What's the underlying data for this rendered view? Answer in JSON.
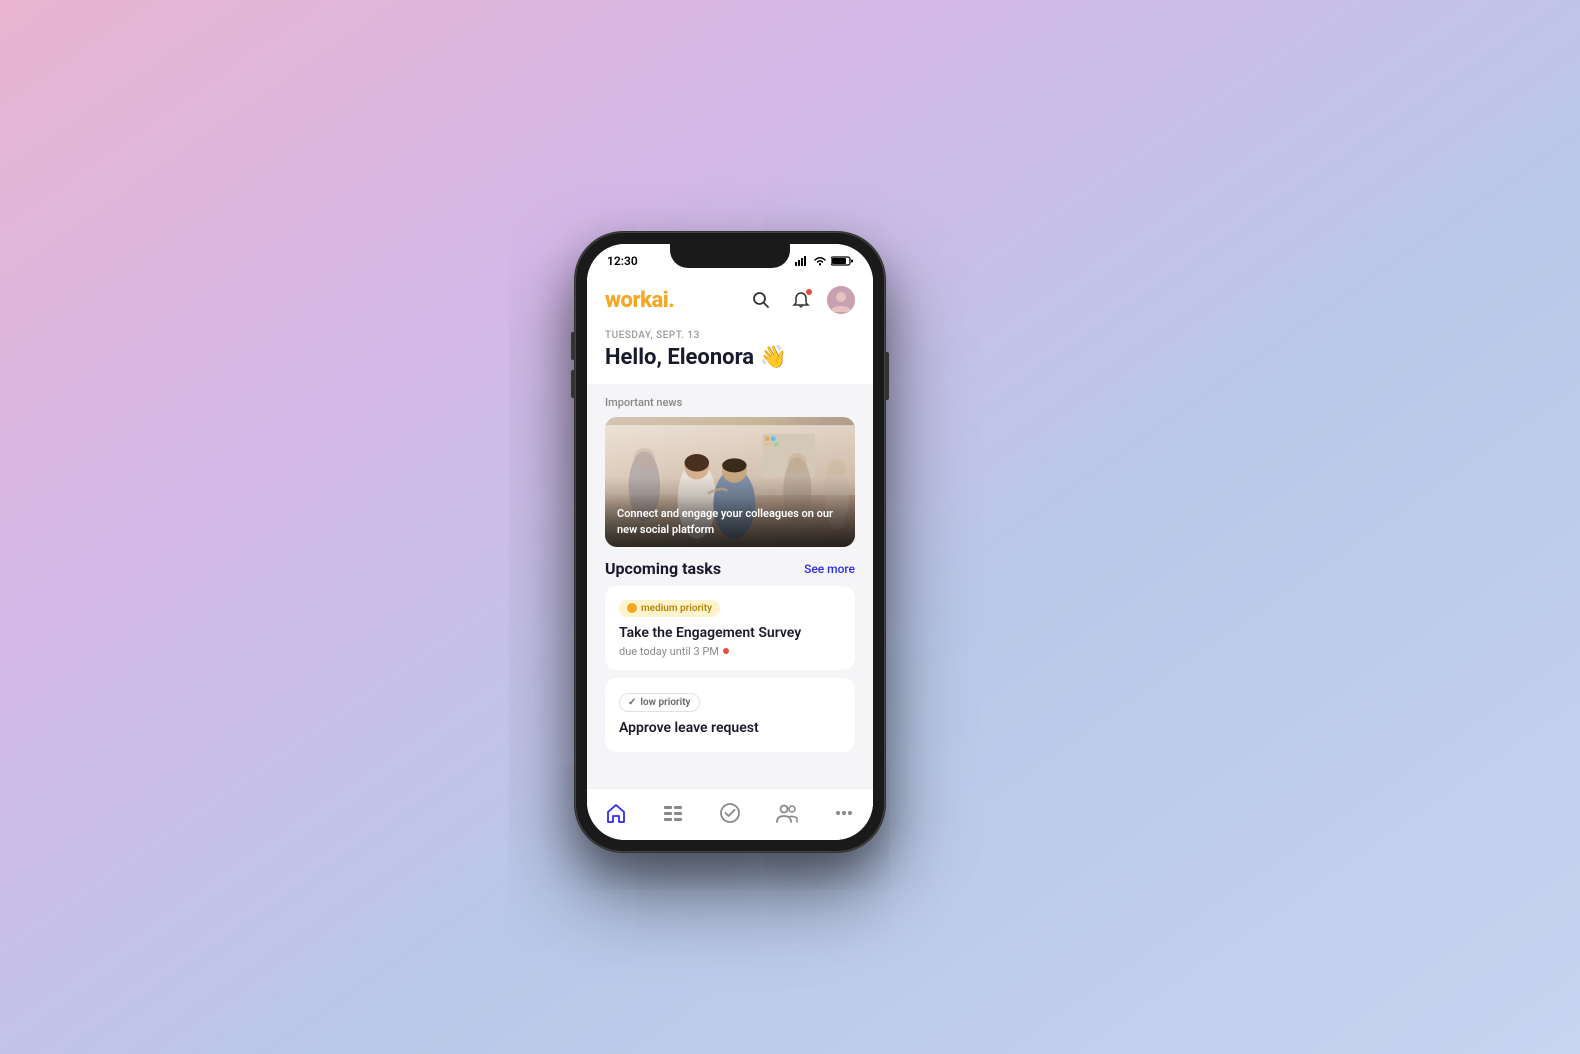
{
  "background": {
    "gradient_from": "#e8b4d0",
    "gradient_to": "#c8d4f0"
  },
  "phone": {
    "status_bar": {
      "time": "12:30",
      "signal": "●●●",
      "wifi": "wifi",
      "battery": "battery"
    }
  },
  "app": {
    "logo": "workai",
    "logo_dot": ".",
    "header": {
      "search_label": "search",
      "notification_label": "notifications",
      "avatar_label": "user avatar"
    },
    "greeting": {
      "date": "TUESDAY, SEPT. 13",
      "text": "Hello, Eleonora 👋"
    },
    "news": {
      "section_label": "Important news",
      "caption": "Connect and engage your colleagues on our new social platform"
    },
    "tasks": {
      "section_title": "Upcoming tasks",
      "see_more": "See more",
      "items": [
        {
          "priority": "medium priority",
          "priority_type": "medium",
          "name": "Take the Engagement Survey",
          "due": "due today until 3 PM"
        },
        {
          "priority": "low priority",
          "priority_type": "low",
          "name": "Approve leave request",
          "due": ""
        }
      ]
    },
    "bottom_nav": [
      {
        "icon": "home",
        "label": "Home",
        "active": true
      },
      {
        "icon": "tasks",
        "label": "Tasks",
        "active": false
      },
      {
        "icon": "check-circle",
        "label": "Check",
        "active": false
      },
      {
        "icon": "people",
        "label": "People",
        "active": false
      },
      {
        "icon": "more",
        "label": "More",
        "active": false
      }
    ]
  }
}
